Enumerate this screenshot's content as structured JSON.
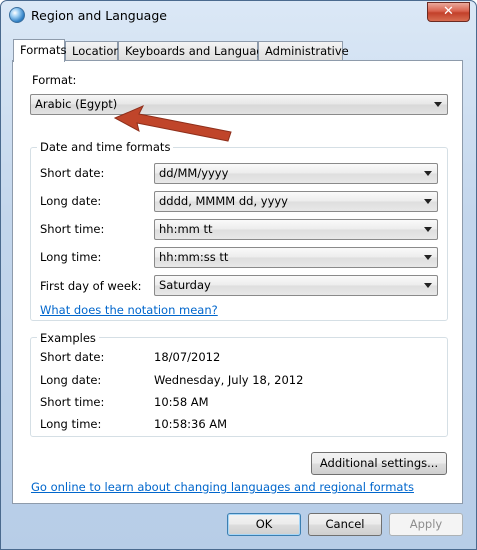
{
  "window": {
    "title": "Region and Language",
    "close_label": "✕"
  },
  "tabs": [
    "Formats",
    "Location",
    "Keyboards and Languages",
    "Administrative"
  ],
  "format": {
    "label": "Format:",
    "value": "Arabic (Egypt)"
  },
  "datetime_group": {
    "title": "Date and time formats",
    "short_date": {
      "label": "Short date:",
      "value": "dd/MM/yyyy"
    },
    "long_date": {
      "label": "Long date:",
      "value": "dddd, MMMM dd, yyyy"
    },
    "short_time": {
      "label": "Short time:",
      "value": "hh:mm tt"
    },
    "long_time": {
      "label": "Long time:",
      "value": "hh:mm:ss tt"
    },
    "first_day": {
      "label": "First day of week:",
      "value": "Saturday"
    },
    "notation_link": "What does the notation mean?"
  },
  "examples": {
    "title": "Examples",
    "rows": [
      {
        "label": "Short date:",
        "value": "18/07/2012"
      },
      {
        "label": "Long date:",
        "value": "Wednesday, July 18, 2012"
      },
      {
        "label": "Short time:",
        "value": "10:58 AM"
      },
      {
        "label": "Long time:",
        "value": "10:58:36 AM"
      }
    ]
  },
  "additional_settings_label": "Additional settings...",
  "online_link": "Go online to learn about changing languages and regional formats",
  "buttons": {
    "ok": "OK",
    "cancel": "Cancel",
    "apply": "Apply"
  },
  "colors": {
    "annotation_arrow": "#c0452a",
    "link": "#0066cc"
  },
  "icons": [
    "globe-icon",
    "close-icon",
    "chevron-down-icon",
    "annotation-arrow-icon"
  ]
}
